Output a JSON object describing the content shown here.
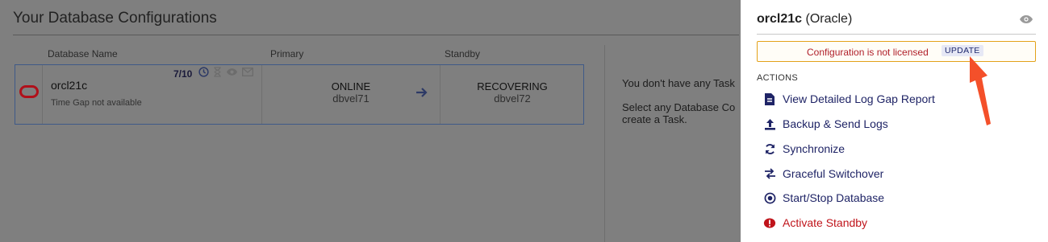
{
  "main": {
    "title": "Your Database Configurations",
    "columns": [
      "Database Name",
      "Primary",
      "Standby"
    ],
    "row": {
      "name": "orcl21c",
      "time_gap": "Time Gap not available",
      "score": "7/10",
      "primary_status": "ONLINE",
      "primary_host": "dbvel71",
      "standby_status": "RECOVERING",
      "standby_host": "dbvel72"
    },
    "task_message_1": "You don't have any Task",
    "task_message_2": "Select any Database Co create a Task."
  },
  "panel": {
    "db_name": "orcl21c",
    "db_type": "(Oracle)",
    "license_text": "Configuration is not licensed",
    "update_label": "UPDATE",
    "actions_heading": "ACTIONS",
    "actions": [
      {
        "label": "View Detailed Log Gap Report",
        "icon": "document-icon"
      },
      {
        "label": "Backup & Send Logs",
        "icon": "upload-icon"
      },
      {
        "label": "Synchronize",
        "icon": "sync-icon"
      },
      {
        "label": "Graceful Switchover",
        "icon": "switch-icon"
      },
      {
        "label": "Start/Stop Database",
        "icon": "power-icon"
      },
      {
        "label": "Activate Standby",
        "icon": "alert-icon"
      }
    ]
  },
  "colors": {
    "accent": "#1f2466",
    "danger": "#c0141b",
    "warning_border": "#e3a21a",
    "overlay": "#808080"
  }
}
